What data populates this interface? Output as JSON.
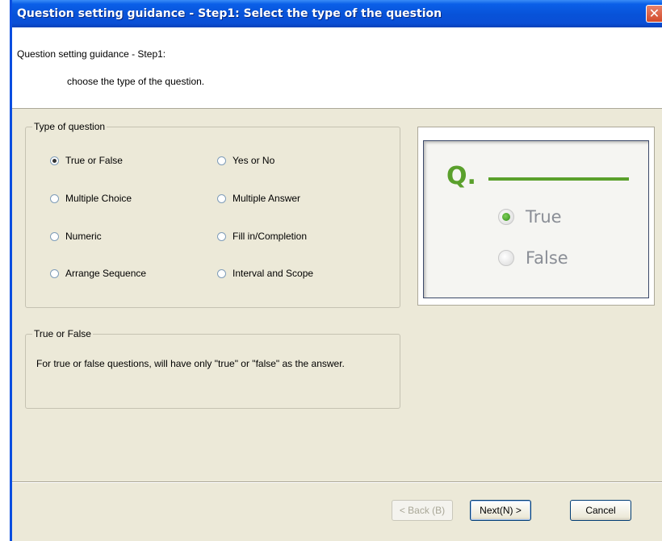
{
  "window": {
    "title": "Question setting guidance - Step1: Select the type of the question",
    "close_symbol": "✕"
  },
  "header": {
    "line1": "Question setting guidance - Step1:",
    "line2": "choose the type of the question."
  },
  "type_group": {
    "legend": "Type of question",
    "options": [
      {
        "label": "True or False",
        "checked": true
      },
      {
        "label": "Yes or No",
        "checked": false
      },
      {
        "label": "Multiple Choice",
        "checked": false
      },
      {
        "label": "Multiple Answer",
        "checked": false
      },
      {
        "label": "Numeric",
        "checked": false
      },
      {
        "label": "Fill in/Completion",
        "checked": false
      },
      {
        "label": "Arrange Sequence",
        "checked": false
      },
      {
        "label": "Interval and Scope",
        "checked": false
      }
    ]
  },
  "description": {
    "legend": "True or False",
    "text": "For true or false questions, will have only \"true\" or \"false\" as the answer."
  },
  "preview": {
    "q_mark": "Q.",
    "options": [
      "True",
      "False"
    ],
    "selected_index": 0,
    "accent_color": "#5aa02c"
  },
  "buttons": {
    "back": "< Back (B)",
    "next": "Next(N) >",
    "cancel": "Cancel"
  }
}
